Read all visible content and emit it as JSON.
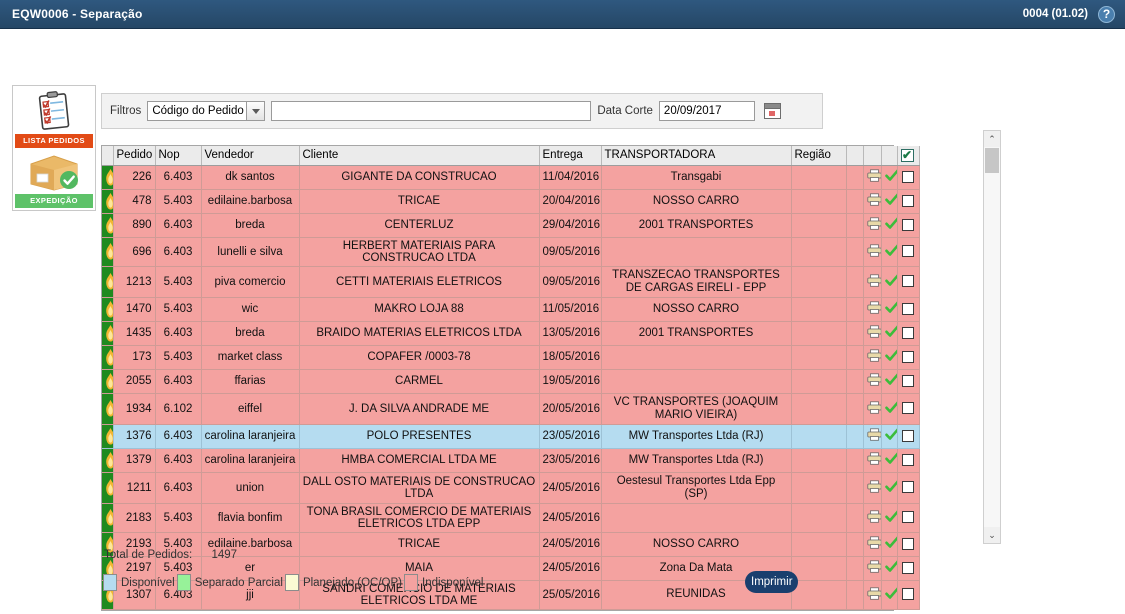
{
  "titlebar": {
    "app_title": "EQW0006 - Separação",
    "version": "0004 (01.02)",
    "help_glyph": "?"
  },
  "sidenav": {
    "tiles": [
      {
        "label": "LISTA PEDIDOS",
        "icon": "clipboard-checklist-icon"
      },
      {
        "label": "EXPEDIÇÃO",
        "icon": "package-box-check-icon"
      }
    ]
  },
  "filters": {
    "label": "Filtros",
    "select_value": "Código do Pedido",
    "text_value": "",
    "text_placeholder": "",
    "date_label": "Data Corte",
    "date_value": "20/09/2017",
    "calendar_icon": "calendar-icon"
  },
  "grid": {
    "columns": [
      {
        "key": "flag",
        "label": ""
      },
      {
        "key": "pedido",
        "label": "Pedido"
      },
      {
        "key": "nop",
        "label": "Nop"
      },
      {
        "key": "vendedor",
        "label": "Vendedor"
      },
      {
        "key": "cliente",
        "label": "Cliente"
      },
      {
        "key": "entrega",
        "label": "Entrega"
      },
      {
        "key": "transportadora",
        "label": "TRANSPORTADORA"
      },
      {
        "key": "regiao",
        "label": "Região"
      },
      {
        "key": "x1",
        "label": ""
      },
      {
        "key": "print",
        "label": ""
      },
      {
        "key": "check",
        "label": ""
      },
      {
        "key": "chk",
        "label": ""
      }
    ],
    "header_checkbox_checked": true,
    "header_check_glyph": "✔",
    "row_icons": {
      "flag": "flame-icon",
      "print": "printer-icon",
      "check": "green-check-icon",
      "checkbox": "row-checkbox"
    },
    "rows": [
      {
        "pedido": "226",
        "nop": "6.403",
        "vendedor": "dk santos",
        "cliente": "GIGANTE DA CONSTRUCAO",
        "entrega": "11/04/2016",
        "transportadora": "Transgabi",
        "regiao": "",
        "status": "unavailable"
      },
      {
        "pedido": "478",
        "nop": "5.403",
        "vendedor": "edilaine.barbosa",
        "cliente": "TRICAE",
        "entrega": "20/04/2016",
        "transportadora": "NOSSO CARRO",
        "regiao": "",
        "status": "unavailable"
      },
      {
        "pedido": "890",
        "nop": "6.403",
        "vendedor": "breda",
        "cliente": "CENTERLUZ",
        "entrega": "29/04/2016",
        "transportadora": "2001 TRANSPORTES",
        "regiao": "",
        "status": "unavailable"
      },
      {
        "pedido": "696",
        "nop": "6.403",
        "vendedor": "lunelli e silva",
        "cliente": "HERBERT MATERIAIS PARA CONSTRUCAO LTDA",
        "entrega": "09/05/2016",
        "transportadora": "",
        "regiao": "",
        "status": "unavailable"
      },
      {
        "pedido": "1213",
        "nop": "5.403",
        "vendedor": "piva comercio",
        "cliente": "CETTI MATERIAIS ELETRICOS",
        "entrega": "09/05/2016",
        "transportadora": "TRANSZECAO TRANSPORTES DE CARGAS EIRELI - EPP",
        "regiao": "",
        "status": "unavailable"
      },
      {
        "pedido": "1470",
        "nop": "5.403",
        "vendedor": "wic",
        "cliente": "MAKRO LOJA 88",
        "entrega": "11/05/2016",
        "transportadora": "NOSSO CARRO",
        "regiao": "",
        "status": "unavailable"
      },
      {
        "pedido": "1435",
        "nop": "6.403",
        "vendedor": "breda",
        "cliente": "BRAIDO MATERIAS ELETRICOS LTDA",
        "entrega": "13/05/2016",
        "transportadora": "2001 TRANSPORTES",
        "regiao": "",
        "status": "unavailable"
      },
      {
        "pedido": "173",
        "nop": "5.403",
        "vendedor": "market class",
        "cliente": "COPAFER /0003-78",
        "entrega": "18/05/2016",
        "transportadora": "",
        "regiao": "",
        "status": "unavailable"
      },
      {
        "pedido": "2055",
        "nop": "6.403",
        "vendedor": "ffarias",
        "cliente": "CARMEL",
        "entrega": "19/05/2016",
        "transportadora": "",
        "regiao": "",
        "status": "unavailable"
      },
      {
        "pedido": "1934",
        "nop": "6.102",
        "vendedor": "eiffel",
        "cliente": "J. DA SILVA ANDRADE ME",
        "entrega": "20/05/2016",
        "transportadora": "VC TRANSPORTES (JOAQUIM MARIO VIEIRA)",
        "regiao": "",
        "status": "unavailable"
      },
      {
        "pedido": "1376",
        "nop": "6.403",
        "vendedor": "carolina laranjeira",
        "cliente": "POLO PRESENTES",
        "entrega": "23/05/2016",
        "transportadora": "MW Transportes Ltda (RJ)",
        "regiao": "",
        "status": "available"
      },
      {
        "pedido": "1379",
        "nop": "6.403",
        "vendedor": "carolina laranjeira",
        "cliente": "HMBA COMERCIAL LTDA ME",
        "entrega": "23/05/2016",
        "transportadora": "MW Transportes Ltda (RJ)",
        "regiao": "",
        "status": "unavailable"
      },
      {
        "pedido": "1211",
        "nop": "6.403",
        "vendedor": "union",
        "cliente": "DALL OSTO MATERIAIS DE CONSTRUCAO LTDA",
        "entrega": "24/05/2016",
        "transportadora": "Oestesul Transportes Ltda Epp (SP)",
        "regiao": "",
        "status": "unavailable"
      },
      {
        "pedido": "2183",
        "nop": "5.403",
        "vendedor": "flavia bonfim",
        "cliente": "TONA BRASIL COMERCIO DE MATERIAIS ELETRICOS LTDA EPP",
        "entrega": "24/05/2016",
        "transportadora": "",
        "regiao": "",
        "status": "unavailable"
      },
      {
        "pedido": "2193",
        "nop": "5.403",
        "vendedor": "edilaine.barbosa",
        "cliente": "TRICAE",
        "entrega": "24/05/2016",
        "transportadora": "NOSSO CARRO",
        "regiao": "",
        "status": "unavailable"
      },
      {
        "pedido": "2197",
        "nop": "5.403",
        "vendedor": "er",
        "cliente": "MAIA",
        "entrega": "24/05/2016",
        "transportadora": "Zona Da Mata",
        "regiao": "",
        "status": "unavailable"
      },
      {
        "pedido": "1307",
        "nop": "6.403",
        "vendedor": "jji",
        "cliente": "SANDRI COMERCIO DE MATERIAIS ELETRICOS LTDA ME",
        "entrega": "25/05/2016",
        "transportadora": "REUNIDAS",
        "regiao": "",
        "status": "unavailable"
      }
    ]
  },
  "scrollbar": {
    "up_glyph": "⌃",
    "down_glyph": "⌄"
  },
  "footer": {
    "total_label": "Total de Pedidos:",
    "total_value": "1497",
    "legend": [
      {
        "label": "Disponível",
        "color": "#b5dcf0"
      },
      {
        "label": "Separado Parcial",
        "color": "#97f299"
      },
      {
        "label": "Planejado (OC/OP)",
        "color": "#fbfbd4"
      },
      {
        "label": "Indisponível",
        "color": "#f4a2a0"
      }
    ],
    "print_button": "Imprimir"
  }
}
